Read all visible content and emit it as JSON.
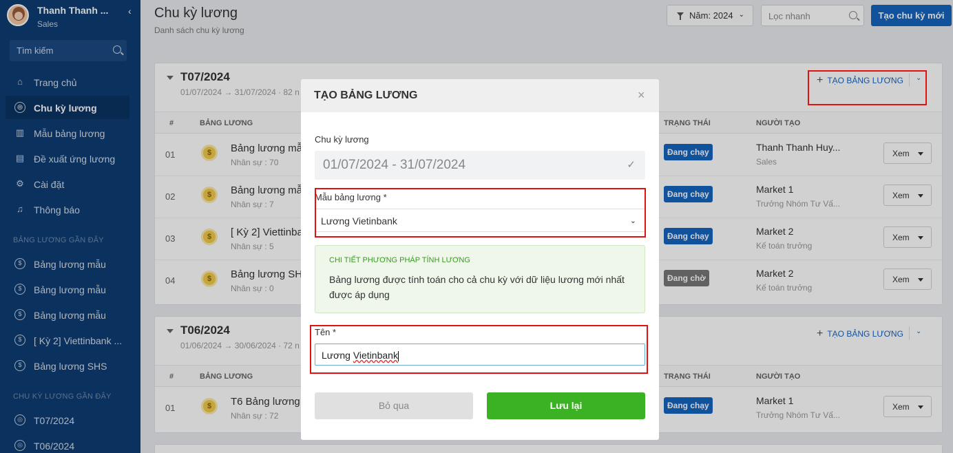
{
  "sidebar": {
    "user_name": "Thanh Thanh ...",
    "user_role": "Sales",
    "collapse_icon": "‹",
    "search_placeholder": "Tìm kiếm",
    "nav": [
      {
        "label": "Trang chủ",
        "icon": "home-icon"
      },
      {
        "label": "Chu kỳ lương",
        "icon": "cycle-icon"
      },
      {
        "label": "Mẫu bảng lương",
        "icon": "template-icon"
      },
      {
        "label": "Đề xuất ứng lương",
        "icon": "document-icon"
      },
      {
        "label": "Cài đặt",
        "icon": "gear-icon"
      },
      {
        "label": "Thông báo",
        "icon": "bell-icon"
      }
    ],
    "recent_payroll_title": "BẢNG LƯƠNG GẦN ĐÂY",
    "recent_payrolls": [
      "Bảng lương mẫu",
      "Bảng lương mẫu",
      "Bảng lương mẫu",
      "[ Kỳ 2] Viettinbank ...",
      "Bảng lương SHS"
    ],
    "recent_cycle_title": "CHU KỲ LƯƠNG GẦN ĐÂY",
    "recent_cycles": [
      "T07/2024",
      "T06/2024"
    ]
  },
  "header": {
    "title": "Chu kỳ lương",
    "subtitle": "Danh sách chu kỳ lương",
    "year_filter": "Năm: 2024",
    "quick_filter_placeholder": "Lọc nhanh",
    "create_button": "Tạo chu kỳ mới"
  },
  "table_columns": {
    "no": "#",
    "payroll": "BẢNG LƯƠNG",
    "status": "TRẠNG THÁI",
    "creator": "NGƯỜI TẠO"
  },
  "periods": [
    {
      "title": "T07/2024",
      "range": "01/07/2024 → 31/07/2024 · 82 n",
      "add_label": "TẠO BẢNG LƯƠNG",
      "rows": [
        {
          "no": "01",
          "name": "Bảng lương mẫ",
          "staff": "Nhân sự : 70",
          "status": "Đang chạy",
          "creator": "Thanh Thanh Huy...",
          "position": "Sales",
          "view": "Xem"
        },
        {
          "no": "02",
          "name": "Bảng lương mẫ",
          "staff": "Nhân sự : 7",
          "status": "Đang chạy",
          "creator": "Market 1",
          "position": "Trưởng Nhóm Tư Vấ...",
          "view": "Xem"
        },
        {
          "no": "03",
          "name": "[ Kỳ 2] Viettinba",
          "staff": "Nhân sự : 5",
          "status": "Đang chạy",
          "creator": "Market 2",
          "position": "Kế toán trưởng",
          "view": "Xem"
        },
        {
          "no": "04",
          "name": "Bảng lương SHS",
          "staff": "Nhân sự : 0",
          "status": "Đang chờ",
          "creator": "Market 2",
          "position": "Kế toán trưởng",
          "view": "Xem"
        }
      ]
    },
    {
      "title": "T06/2024",
      "range": "01/06/2024 → 30/06/2024 · 72 n",
      "add_label": "TẠO BẢNG LƯƠNG",
      "rows": [
        {
          "no": "01",
          "name": "T6 Bảng lương",
          "staff": "Nhân sự : 72",
          "status": "Đang chạy",
          "creator": "Market 1",
          "position": "Trưởng Nhóm Tư Vấ...",
          "view": "Xem"
        }
      ]
    }
  ],
  "modal": {
    "title": "TẠO BẢNG LƯƠNG",
    "close": "×",
    "period_label": "Chu kỳ lương",
    "period_value": "01/07/2024 - 31/07/2024",
    "template_label": "Mẫu bảng lương *",
    "template_value": "Lương Vietinbank",
    "info_title": "CHI TIẾT PHƯƠNG PHÁP TÍNH LƯƠNG",
    "info_text": "Bảng lương được tính toán cho cả chu kỳ với dữ liệu lương mới nhất được áp dụng",
    "name_label": "Tên *",
    "name_prefix": "Lương ",
    "name_misspelled": "Vietinbank",
    "cancel": "Bỏ qua",
    "save": "Lưu lại"
  },
  "colors": {
    "sidebar": "#0e3d74",
    "primary": "#1565c0",
    "save": "#3bb224",
    "highlight": "#e0110f"
  }
}
